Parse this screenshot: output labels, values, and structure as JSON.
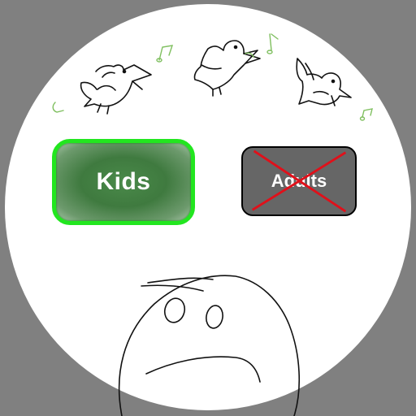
{
  "menu": {
    "kids_label": "Kids",
    "adults_label": "Adults",
    "adults_state": "disabled"
  },
  "colors": {
    "background": "#808080",
    "circle": "#ffffff",
    "kids_border": "#22e61f",
    "kids_fill": "#3f7a3f",
    "adults_fill": "#666666",
    "cross": "#e0101a",
    "notes": "#7fbf5f"
  },
  "icons": [
    "bird-icon",
    "music-note-icon",
    "sad-face-icon",
    "cross-out-icon"
  ]
}
